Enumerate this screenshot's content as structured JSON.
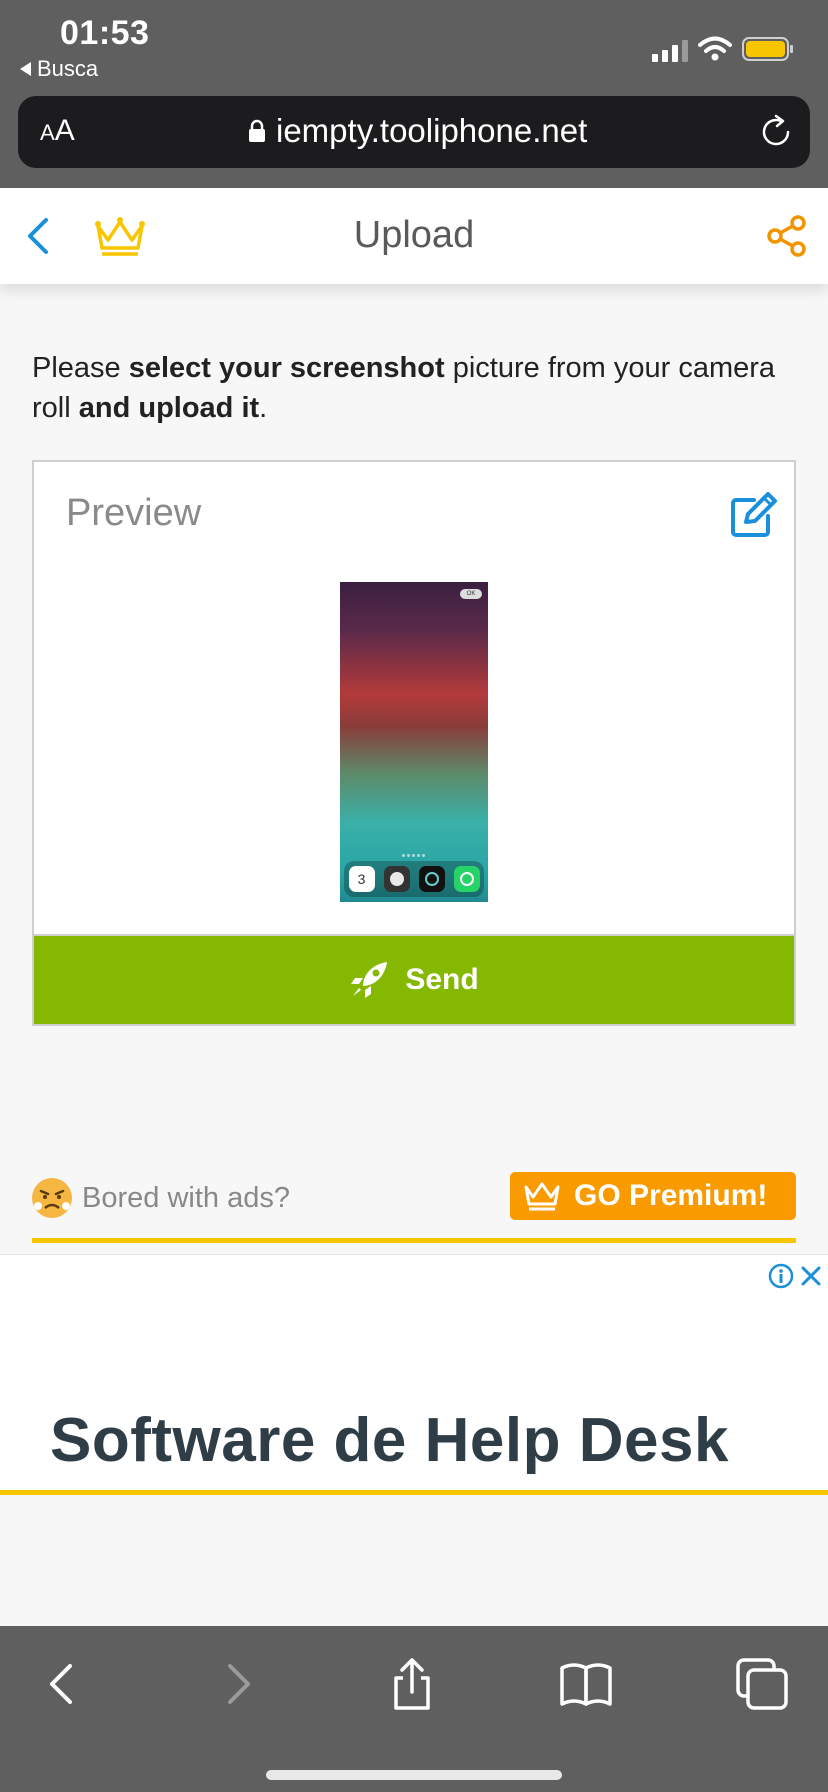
{
  "status_bar": {
    "time": "01:53",
    "back_app": "Busca"
  },
  "url_bar": {
    "text_size_label_small": "A",
    "text_size_label": "A",
    "url": "iempty.tooliphone.net"
  },
  "nav": {
    "title": "Upload"
  },
  "intro": {
    "p1": "Please ",
    "b1": "select your screenshot",
    "p2": " picture from your camera roll ",
    "b2": "and upload it",
    "p3": "."
  },
  "card": {
    "preview_label": "Preview",
    "thumb_ok": "OK",
    "dock_calendar_day": "3",
    "send_label": "Send"
  },
  "promo": {
    "bored_text": "Bored with ads?",
    "premium_label": "GO Premium!"
  },
  "ad": {
    "headline": "Software de Help Desk"
  },
  "colors": {
    "accent_blue": "#1a8fdc",
    "crown_yellow": "#f7c600",
    "share_orange": "#f29400",
    "send_green": "#85b800",
    "premium_orange": "#f99a00"
  }
}
